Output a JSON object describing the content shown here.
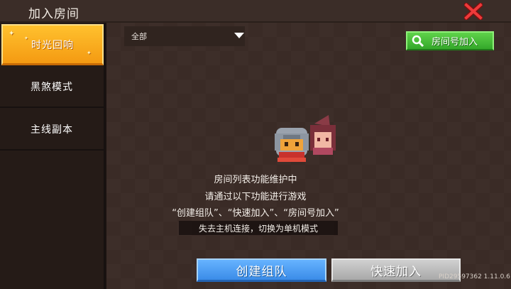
{
  "window": {
    "title": "加入房间"
  },
  "sidebar": {
    "items": [
      {
        "label": "时光回响",
        "active": true
      },
      {
        "label": "黑煞模式",
        "active": false
      },
      {
        "label": "主线副本",
        "active": false
      }
    ]
  },
  "filter": {
    "selected": "全部"
  },
  "search_button": {
    "label": "房间号加入"
  },
  "notice": {
    "line1": "房间列表功能维护中",
    "line2": "请通过以下功能进行游戏",
    "line3": "“创建组队”、“快速加入”、“房间号加入”"
  },
  "toast": "失去主机连接，切换为单机模式",
  "buttons": {
    "create": "创建组队",
    "quick": "快速加入"
  },
  "footer": {
    "pid": "PID29597362 1.11.0.6"
  },
  "colors": {
    "active_tab": "#f7a617",
    "search_green": "#3fb832",
    "create_blue": "#4a9af0",
    "quick_gray": "#bdbdbd",
    "close_red": "#e03030"
  }
}
